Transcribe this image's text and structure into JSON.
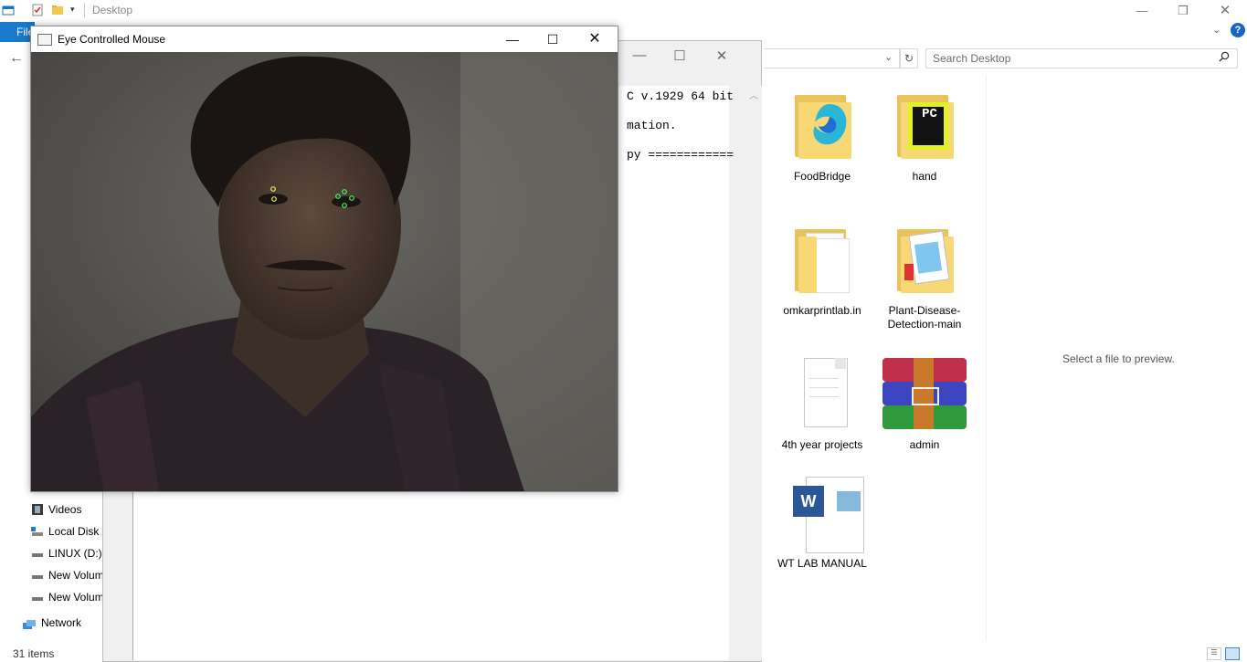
{
  "explorer": {
    "title": "Desktop",
    "file_tab": "File",
    "search_placeholder": "Search Desktop",
    "status": "31 items",
    "preview": "Select a file to preview.",
    "nav": [
      {
        "label": "Videos"
      },
      {
        "label": "Local Disk (C:)"
      },
      {
        "label": "LINUX (D:)"
      },
      {
        "label": "New Volume (E:)"
      },
      {
        "label": "New Volume (F:)"
      }
    ],
    "network": "Network",
    "files": [
      {
        "name": "FoodBridge",
        "type": "folder"
      },
      {
        "name": "hand",
        "type": "folder"
      },
      {
        "name": "omkarprintlab.in",
        "type": "folder"
      },
      {
        "name": "Plant-Disease-Detection-main",
        "type": "folder"
      },
      {
        "name": "4th year projects",
        "type": "file"
      },
      {
        "name": "admin",
        "type": "archive"
      },
      {
        "name": "WT LAB MANUAL",
        "type": "docx"
      }
    ]
  },
  "console": {
    "lines": [
      "C v.1929 64 bit",
      "mation.",
      "py ============"
    ]
  },
  "eye_window": {
    "title": "Eye Controlled Mouse",
    "minimize": "—",
    "maximize": "☐",
    "close": "✕"
  },
  "colors": {
    "accent": "#1979ca",
    "landmark_yellow": "#f0f070",
    "landmark_green": "#3cff5a"
  }
}
